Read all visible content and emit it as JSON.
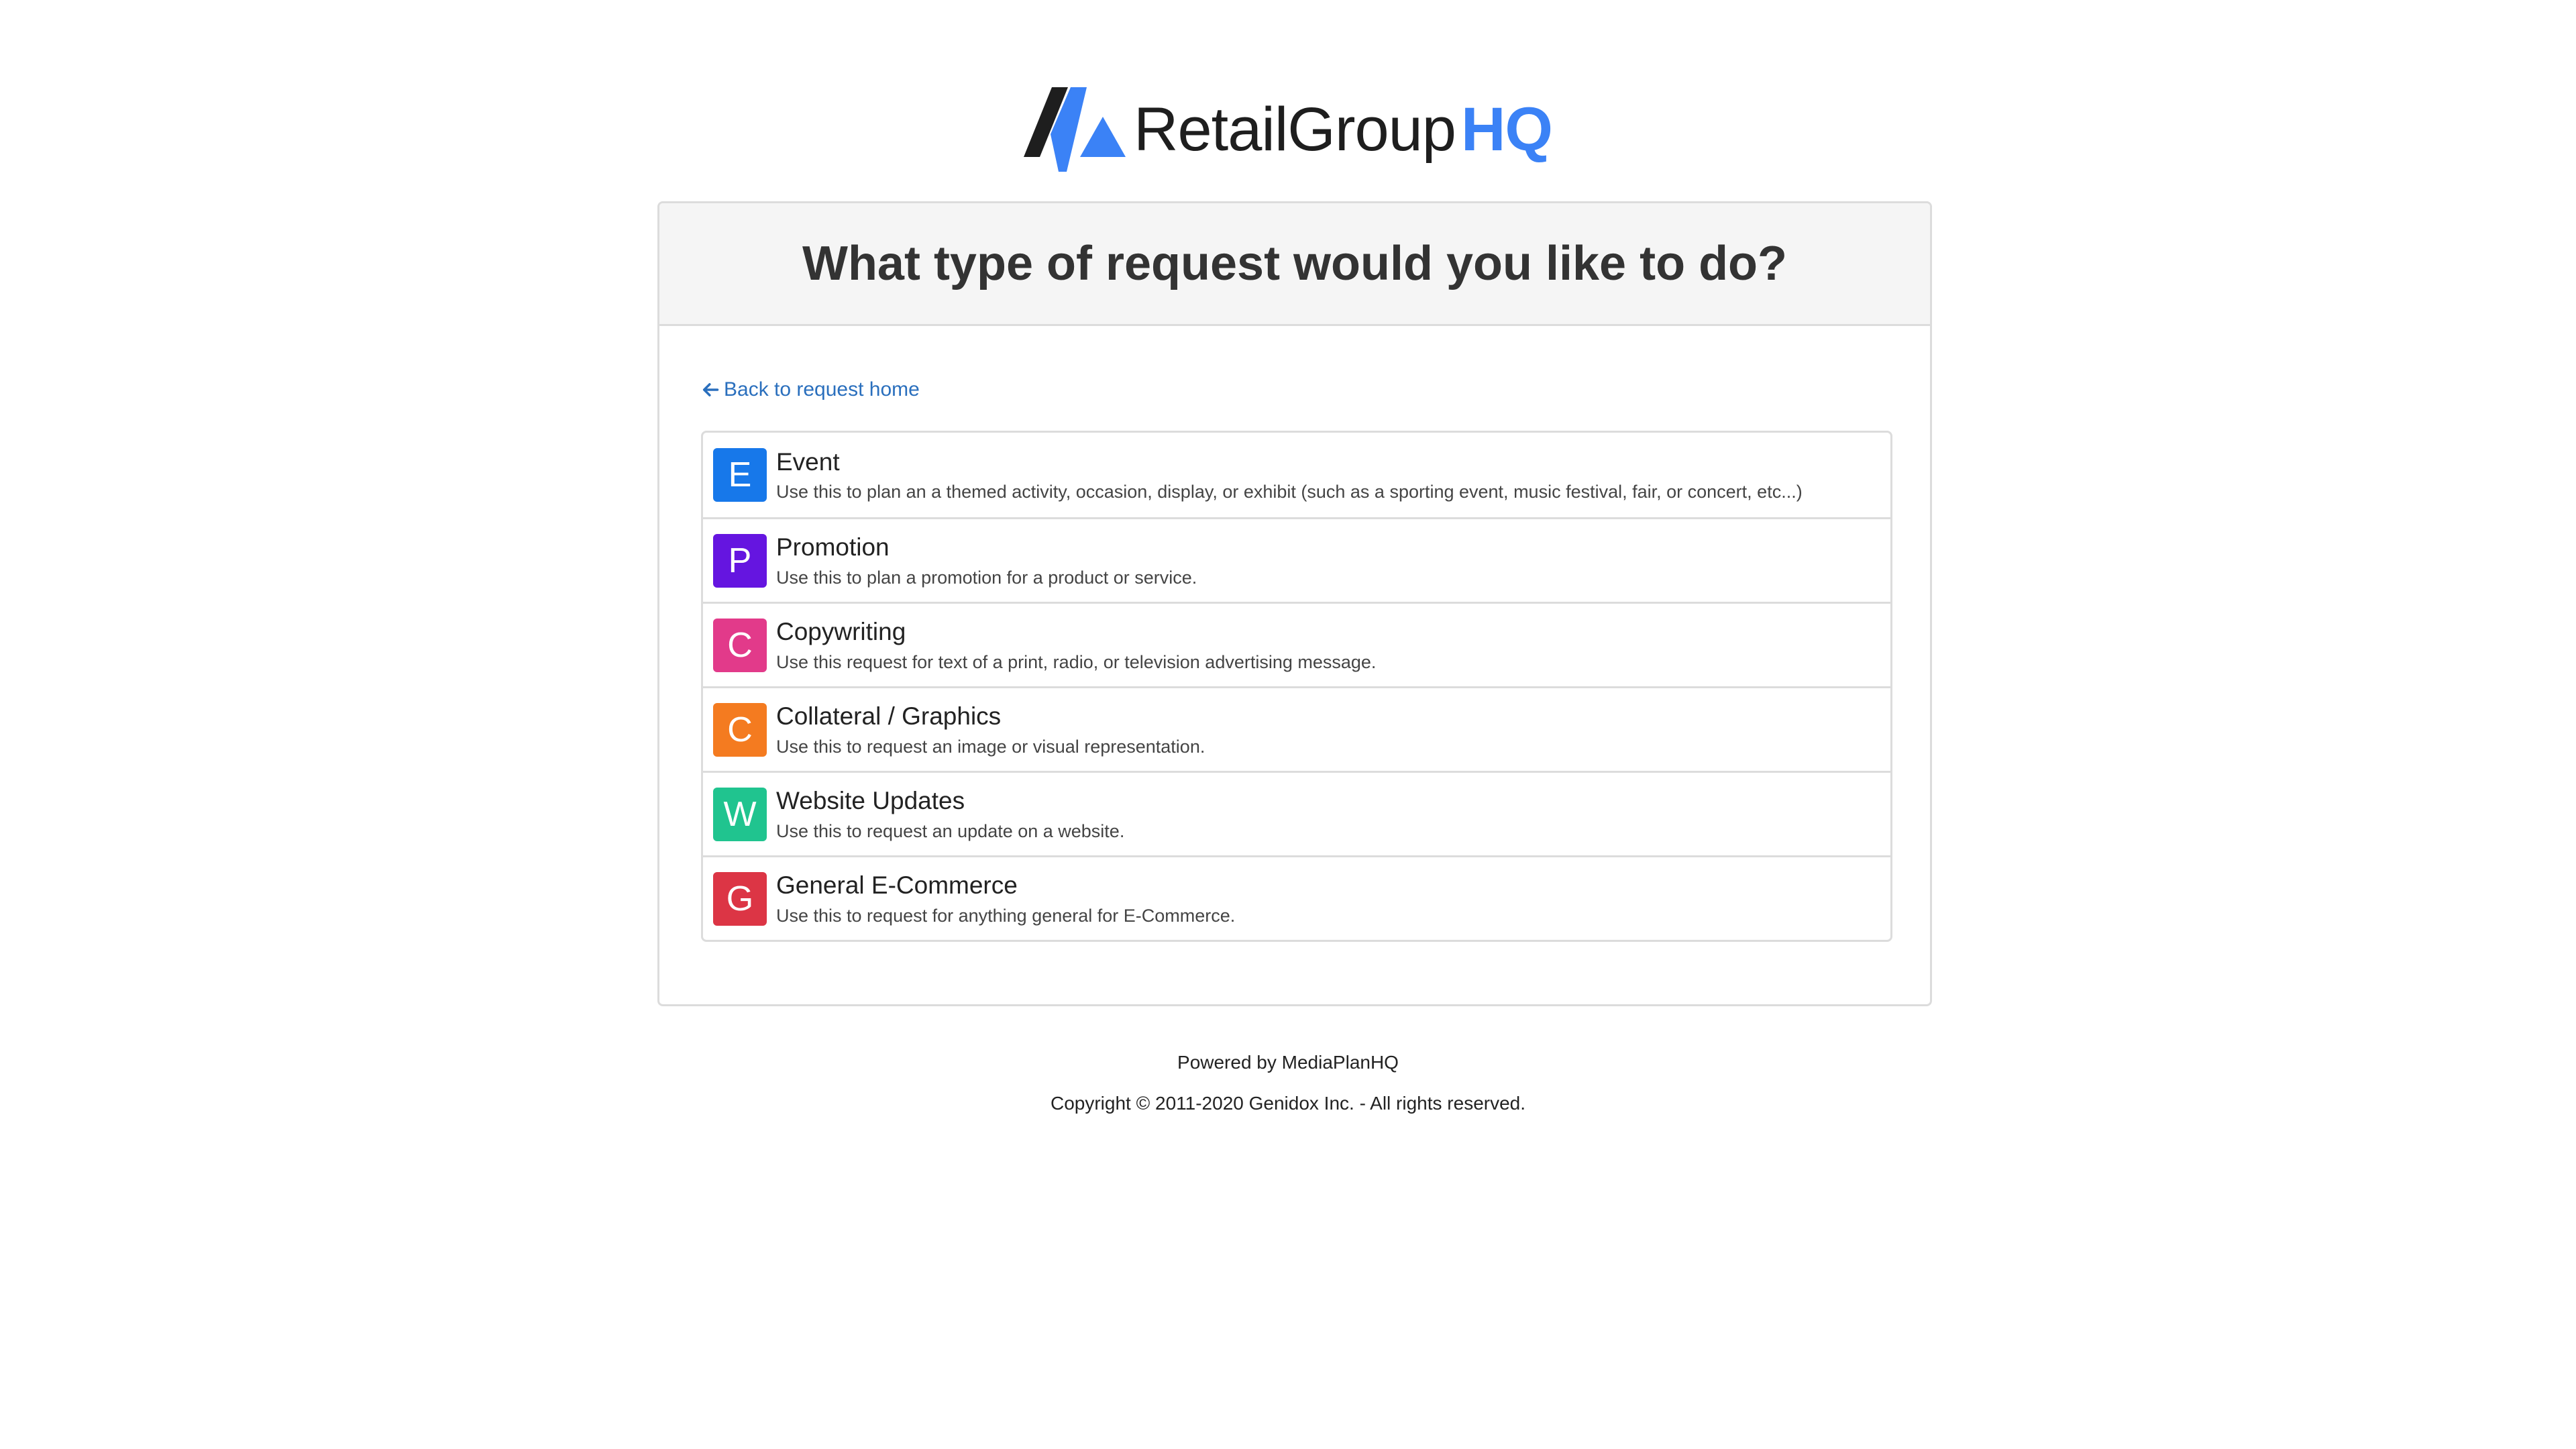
{
  "brand": {
    "logo_text_main": "RetailGroup",
    "logo_text_accent": "HQ",
    "accent_color": "#3b82f6",
    "icon": "retailgroup-logo-mark"
  },
  "card": {
    "title": "What type of request would you like to do?"
  },
  "back_link": {
    "label": "Back to request home",
    "icon": "arrow-left-icon"
  },
  "request_types": [
    {
      "letter": "E",
      "title": "Event",
      "description": "Use this to plan an a themed activity, occasion, display, or exhibit (such as a sporting event, music festival, fair, or concert, etc...)",
      "color": "#1778ea"
    },
    {
      "letter": "P",
      "title": "Promotion",
      "description": "Use this to plan a promotion for a product or service.",
      "color": "#6515e0"
    },
    {
      "letter": "C",
      "title": "Copywriting",
      "description": "Use this request for text of a print, radio, or television advertising message.",
      "color": "#e23a8a"
    },
    {
      "letter": "C",
      "title": "Collateral / Graphics",
      "description": "Use this to request an image or visual representation.",
      "color": "#f47b20"
    },
    {
      "letter": "W",
      "title": "Website Updates",
      "description": "Use this to request an update on a website.",
      "color": "#20c48f"
    },
    {
      "letter": "G",
      "title": "General E-Commerce",
      "description": "Use this to request for anything general for E-Commerce.",
      "color": "#dc3545"
    }
  ],
  "footer": {
    "powered_by": "Powered by MediaPlanHQ",
    "copyright": "Copyright © 2011-2020 Genidox Inc. - All rights reserved."
  }
}
